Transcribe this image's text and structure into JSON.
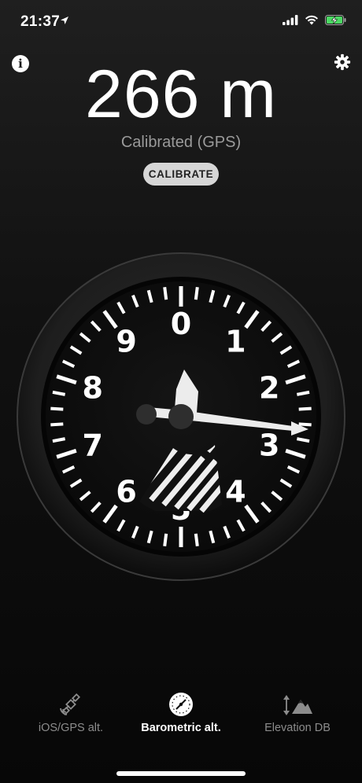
{
  "status": {
    "time": "21:37"
  },
  "altitude": {
    "value": "266 m",
    "status": "Calibrated (GPS)"
  },
  "calibrate_label": "CALIBRATE",
  "gauge": {
    "numbers": [
      "0",
      "1",
      "2",
      "3",
      "4",
      "5",
      "6",
      "7",
      "8",
      "9"
    ],
    "short_hand_reading": 0.27,
    "long_hand_reading": 2.8,
    "colors": {
      "face": "#111111",
      "bezel": "#2a2a2a",
      "marks": "#ffffff"
    }
  },
  "tabs": [
    {
      "label": "iOS/GPS alt.",
      "icon": "satellite-icon",
      "active": false
    },
    {
      "label": "Barometric alt.",
      "icon": "barometer-icon",
      "active": true
    },
    {
      "label": "Elevation DB",
      "icon": "mountain-elevation-icon",
      "active": false
    }
  ]
}
